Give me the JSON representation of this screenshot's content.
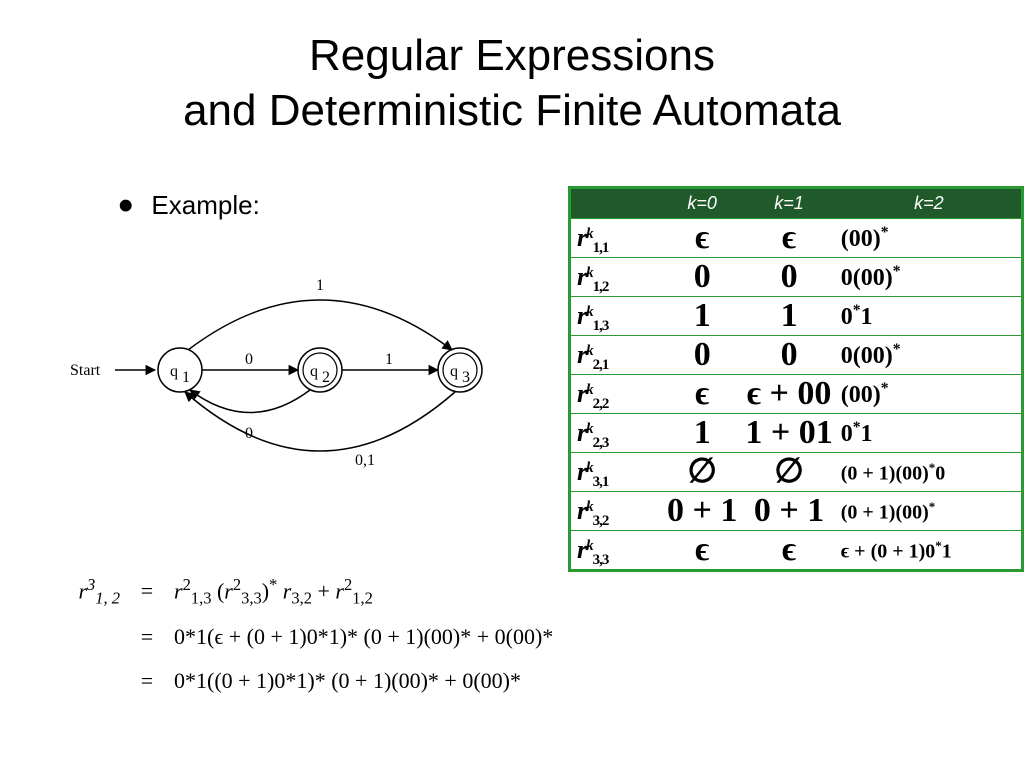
{
  "title_line1": "Regular Expressions",
  "title_line2": "and Deterministic Finite Automata",
  "example_label": "Example:",
  "dfa": {
    "start_label": "Start",
    "states": {
      "q1": "q",
      "q1sub": "1",
      "q2": "q",
      "q2sub": "2",
      "q3": "q",
      "q3sub": "3"
    },
    "edges": {
      "q1_q3_top": "1",
      "q1_q2": "0",
      "q2_q3": "1",
      "q2_q1_bottom": "0",
      "q3_q1_bottom": "0,1"
    }
  },
  "table": {
    "headers": {
      "blank": "",
      "k0": "k=0",
      "k1": "k=1",
      "k2": "k=2"
    },
    "rows": [
      {
        "label_sub": "1,1",
        "k0": "ϵ",
        "k1": "ϵ",
        "k2": "(00)*"
      },
      {
        "label_sub": "1,2",
        "k0": "0",
        "k1": "0",
        "k2": "0(00)*"
      },
      {
        "label_sub": "1,3",
        "k0": "1",
        "k1": "1",
        "k2": "0*1"
      },
      {
        "label_sub": "2,1",
        "k0": "0",
        "k1": "0",
        "k2": "0(00)*"
      },
      {
        "label_sub": "2,2",
        "k0": "ϵ",
        "k1": "ϵ + 00",
        "k2": "(00)*"
      },
      {
        "label_sub": "2,3",
        "k0": "1",
        "k1": "1 + 01",
        "k2": "0*1"
      },
      {
        "label_sub": "3,1",
        "k0": "∅",
        "k1": "∅",
        "k2": "(0 + 1)(00)*0",
        "small": true
      },
      {
        "label_sub": "3,2",
        "k0": "0 + 1",
        "k1": "0 + 1",
        "k2": "(0 + 1)(00)*",
        "small": true
      },
      {
        "label_sub": "3,3",
        "k0": "ϵ",
        "k1": "ϵ",
        "k2": "ϵ + (0 + 1)0*1",
        "small": true
      }
    ],
    "row_symbol": "r",
    "row_super": "k"
  },
  "derivation": {
    "lhs": "r",
    "lhs_sup": "3",
    "lhs_sub": "1, 2",
    "eq": "=",
    "line1": "r¹,₃² (r³,₃²)* r₃,₂ + r¹,₂²",
    "line2": "0*1(ϵ + (0 + 1)0*1)* (0 + 1)(00)* + 0(00)*",
    "line3": "0*1((0 + 1)0*1)* (0 + 1)(00)* + 0(00)*"
  }
}
